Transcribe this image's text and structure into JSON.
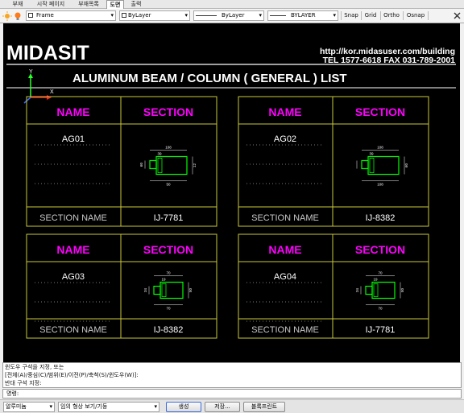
{
  "tabs": [
    "부재",
    "시작 페이지",
    "부재목록",
    "도면",
    "출력"
  ],
  "active_tab": 3,
  "toolbar": {
    "layer_value": "Frame",
    "color_value": "ByLayer",
    "linetype_value": "ByLayer",
    "lineweight_value": "BYLAYER",
    "buttons": [
      "Snap",
      "Grid",
      "Ortho",
      "Osnap"
    ]
  },
  "drawing": {
    "company": "MIDASIT",
    "url": "http://kor.midasuser.com/building",
    "contact": "TEL 1577-6618  FAX 031-789-2001",
    "title": "ALUMINUM BEAM / COLUMN ( GENERAL ) LIST",
    "axis": {
      "y": "Y",
      "x": "X"
    },
    "header_name": "NAME",
    "header_section": "SECTION",
    "footer_label": "SECTION NAME",
    "sections": [
      {
        "name": "AG01",
        "section": "IJ-7781",
        "dims": [
          "108",
          "39",
          "12",
          "60",
          "108",
          "50"
        ]
      },
      {
        "name": "AG02",
        "section": "IJ-8382",
        "dims": [
          "108",
          "39",
          "60",
          "108"
        ]
      },
      {
        "name": "AG03",
        "section": "IJ-8382",
        "dims": [
          "70",
          "19",
          "50",
          "34",
          "70"
        ]
      },
      {
        "name": "AG04",
        "section": "IJ-7781",
        "dims": [
          "70",
          "19",
          "50",
          "34",
          "70"
        ]
      }
    ]
  },
  "command": {
    "lines": [
      "윈도우 구석을 지정, 또는",
      "[전체(A)/중심(C)/범위(E)/이전(P)/축척(S)/윈도우(W)]:",
      "반대 구석 지정:"
    ],
    "prompt": "명령:"
  },
  "statusbar": {
    "unit_select": "알루미늄",
    "mode_select": "임의 형상 보기/기둥",
    "generate": "생성",
    "save": "저장...",
    "blockprint": "블록프린트"
  },
  "colors": {
    "frame": "#c8c83a",
    "heading": "#ff00ff",
    "shape": "#00ff00",
    "dim": "#ffffff"
  }
}
